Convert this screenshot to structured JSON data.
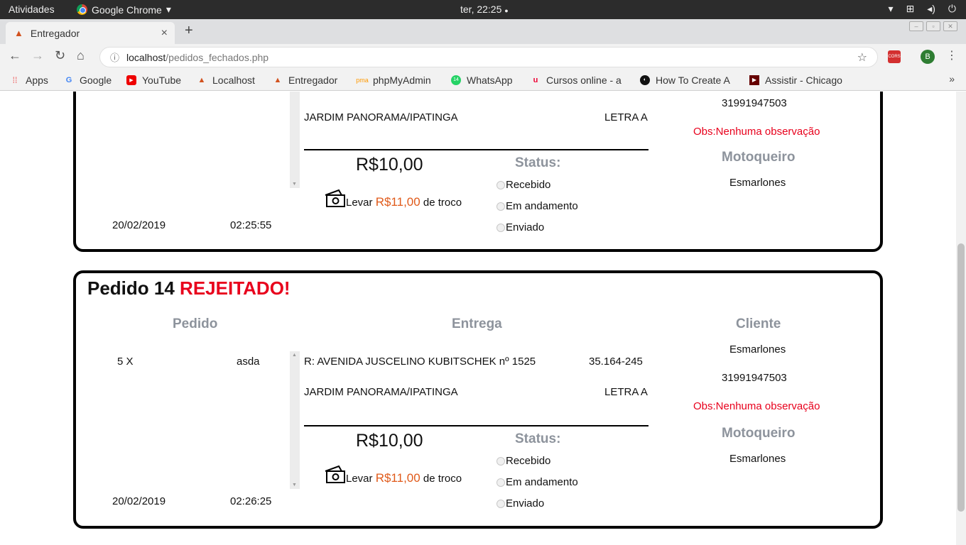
{
  "os": {
    "activities": "Atividades",
    "app_name": "Google Chrome",
    "app_caret": "▾",
    "clock": "ter, 22:25",
    "clock_dot": "●",
    "tray": {
      "network": "⊞",
      "volume": "◂)",
      "power": "⏻",
      "caret": "▾"
    }
  },
  "browser": {
    "tab_title": "Entregador",
    "tab_close": "×",
    "new_tab": "+",
    "url_host": "localhost",
    "url_path": "/pedidos_fechados.php",
    "ext_label": "CORS",
    "avatar_letter": "B",
    "bookmarks": [
      {
        "label": "Apps",
        "icon": "apps-grid-icon"
      },
      {
        "label": "Google",
        "icon": "google-icon"
      },
      {
        "label": "YouTube",
        "icon": "youtube-icon"
      },
      {
        "label": "Localhost",
        "icon": "localhost-icon"
      },
      {
        "label": "Entregador",
        "icon": "entregador-icon"
      },
      {
        "label": "phpMyAdmin",
        "icon": "phpmyadmin-icon"
      },
      {
        "label": "WhatsApp",
        "icon": "whatsapp-icon"
      },
      {
        "label": "Cursos online - a",
        "icon": "udemy-icon"
      },
      {
        "label": "How To Create A",
        "icon": "howto-icon"
      },
      {
        "label": "Assistir - Chicago",
        "icon": "play-icon"
      }
    ],
    "more": "»"
  },
  "orders": [
    {
      "phone": "31991947503",
      "address_line2": "JARDIM PANORAMA/IPATINGA",
      "complement": "LETRA A",
      "obs": "Obs:Nenhuma observação",
      "price": "R$10,00",
      "status_header": "Status:",
      "change_prefix": "Levar ",
      "change_value": "R$11,00",
      "change_suffix": " de troco",
      "status_options": [
        "Recebido",
        "Em andamento",
        "Enviado"
      ],
      "courier_header": "Motoqueiro",
      "courier": "Esmarlones",
      "date": "20/02/2019",
      "time": "02:25:55"
    },
    {
      "title": "Pedido 14 ",
      "title_status": "REJEITADO!",
      "headers": {
        "pedido": "Pedido",
        "entrega": "Entrega",
        "cliente": "Cliente"
      },
      "qty": "5 X",
      "item": "asda",
      "address_line1": "R: AVENIDA JUSCELINO KUBITSCHEK nº 1525",
      "cep": "35.164-245",
      "address_line2": "JARDIM PANORAMA/IPATINGA",
      "complement": "LETRA A",
      "client_name": "Esmarlones",
      "phone": "31991947503",
      "obs": "Obs:Nenhuma observação",
      "price": "R$10,00",
      "status_header": "Status:",
      "change_prefix": "Levar ",
      "change_value": "R$11,00",
      "change_suffix": " de troco",
      "status_options": [
        "Recebido",
        "Em andamento",
        "Enviado"
      ],
      "courier_header": "Motoqueiro",
      "courier": "Esmarlones",
      "date": "20/02/2019",
      "time": "02:26:25"
    }
  ]
}
